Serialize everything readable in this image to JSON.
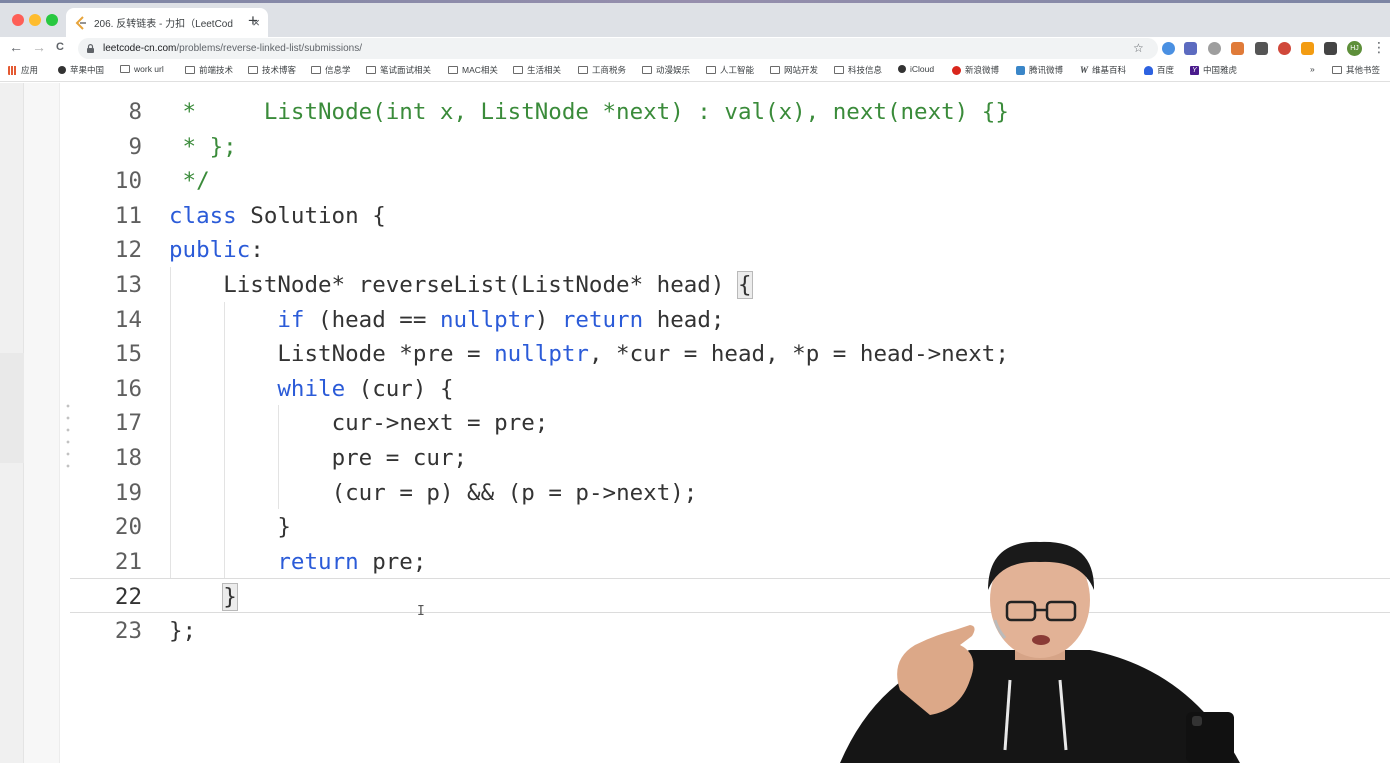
{
  "browser": {
    "tab": {
      "title": "206. 反转链表 - 力扣（LeetCod",
      "close": "×"
    },
    "new_tab": "+",
    "nav": {
      "back": "←",
      "forward": "→",
      "reload": "C"
    },
    "url": {
      "host": "leetcode-cn.com",
      "path": "/problems/reverse-linked-list/submissions/"
    },
    "star": "☆",
    "avatar": "HJ",
    "menu": "⋮",
    "extensions": [
      "#4a90e2",
      "#5c6bc0",
      "#9e9e9e",
      "#e07b39",
      "#555555",
      "#d0483a",
      "#f39c12",
      "#444444"
    ],
    "bookmarks": [
      {
        "label": "应用",
        "icon": "grid"
      },
      {
        "label": "苹果中国",
        "icon": "dot"
      },
      {
        "label": "work url",
        "icon": "folder"
      },
      {
        "label": "前端技术",
        "icon": "folder"
      },
      {
        "label": "技术博客",
        "icon": "folder"
      },
      {
        "label": "信息学",
        "icon": "folder"
      },
      {
        "label": "笔试面试相关",
        "icon": "folder"
      },
      {
        "label": "MAC相关",
        "icon": "folder"
      },
      {
        "label": "生活相关",
        "icon": "folder"
      },
      {
        "label": "工商税务",
        "icon": "folder"
      },
      {
        "label": "动漫娱乐",
        "icon": "folder"
      },
      {
        "label": "人工智能",
        "icon": "folder"
      },
      {
        "label": "网站开发",
        "icon": "folder"
      },
      {
        "label": "科技信息",
        "icon": "folder"
      },
      {
        "label": "iCloud",
        "icon": "dot"
      },
      {
        "label": "新浪微博",
        "icon": "wb"
      },
      {
        "label": "腾讯微博",
        "icon": "qq"
      },
      {
        "label": "维基百科",
        "icon": "w"
      },
      {
        "label": "百度",
        "icon": "bd"
      },
      {
        "label": "中国雅虎",
        "icon": "y"
      }
    ],
    "bookmarks_more": "»",
    "other_bookmarks": "其他书签"
  },
  "editor": {
    "lines": [
      {
        "n": "8",
        "indent": 0,
        "tokens": [
          [
            "cm",
            " *     ListNode(int x, ListNode *next) : val(x), next(next) {}"
          ]
        ]
      },
      {
        "n": "9",
        "indent": 0,
        "tokens": [
          [
            "cm",
            " * };"
          ]
        ]
      },
      {
        "n": "10",
        "indent": 0,
        "tokens": [
          [
            "cm",
            " */"
          ]
        ]
      },
      {
        "n": "11",
        "indent": 0,
        "tokens": [
          [
            "kw",
            "class"
          ],
          [
            "",
            " Solution {"
          ]
        ]
      },
      {
        "n": "12",
        "indent": 0,
        "tokens": [
          [
            "kw",
            "public"
          ],
          [
            "",
            ":"
          ]
        ]
      },
      {
        "n": "13",
        "indent": 1,
        "tokens": [
          [
            "",
            "ListNode* reverseList(ListNode* head) "
          ],
          [
            "hl",
            "{"
          ]
        ]
      },
      {
        "n": "14",
        "indent": 2,
        "tokens": [
          [
            "kw",
            "if"
          ],
          [
            "",
            " (head == "
          ],
          [
            "kw",
            "nullptr"
          ],
          [
            "",
            ") "
          ],
          [
            "kw",
            "return"
          ],
          [
            "",
            " head;"
          ]
        ]
      },
      {
        "n": "15",
        "indent": 2,
        "tokens": [
          [
            "",
            "ListNode *pre = "
          ],
          [
            "kw",
            "nullptr"
          ],
          [
            "",
            ", *cur = head, *p = head->next;"
          ]
        ]
      },
      {
        "n": "16",
        "indent": 2,
        "tokens": [
          [
            "kw",
            "while"
          ],
          [
            "",
            " (cur) {"
          ]
        ]
      },
      {
        "n": "17",
        "indent": 3,
        "tokens": [
          [
            "",
            "cur->next = pre;"
          ]
        ]
      },
      {
        "n": "18",
        "indent": 3,
        "tokens": [
          [
            "",
            "pre = cur;"
          ]
        ]
      },
      {
        "n": "19",
        "indent": 3,
        "tokens": [
          [
            "",
            "(cur = p) && (p = p->next);"
          ]
        ]
      },
      {
        "n": "20",
        "indent": 2,
        "tokens": [
          [
            "",
            "}"
          ]
        ]
      },
      {
        "n": "21",
        "indent": 2,
        "tokens": [
          [
            "kw",
            "return"
          ],
          [
            "",
            " pre;"
          ]
        ]
      },
      {
        "n": "22",
        "indent": 1,
        "active": true,
        "tokens": [
          [
            "hl",
            "}"
          ]
        ]
      },
      {
        "n": "23",
        "indent": 0,
        "tokens": [
          [
            "",
            "};"
          ]
        ]
      }
    ]
  },
  "cursor_glyph": "I"
}
